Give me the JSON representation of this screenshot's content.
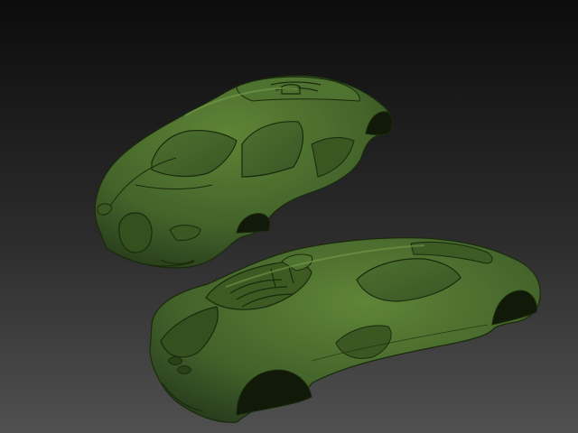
{
  "scene": {
    "description_free": true,
    "colors": {
      "viewport_top": "#0c0c0c",
      "viewport_bottom": "#4f4f4f",
      "body_base": "#3f5e22",
      "body_light": "#5b7f34",
      "body_dark": "#1f3010",
      "line": "#1a2a0c",
      "highlight": "#7a9f4e"
    },
    "objects": [
      {
        "name": "car-model-rear-view",
        "icon": "car-body-mesh"
      },
      {
        "name": "car-model-front-view",
        "icon": "car-body-mesh"
      }
    ]
  }
}
